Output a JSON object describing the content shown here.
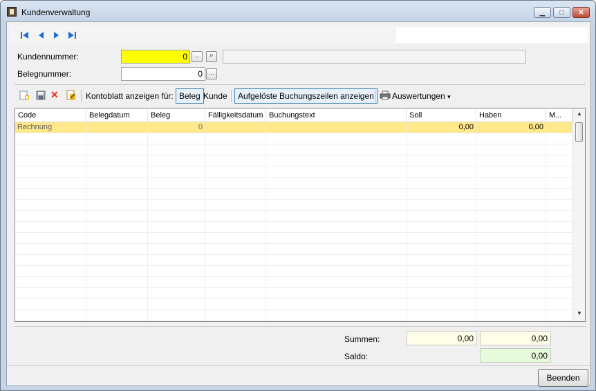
{
  "window": {
    "title": "Kundenverwaltung",
    "minimize_glyph": "▁",
    "maximize_glyph": "□",
    "close_glyph": "✕"
  },
  "nav": {
    "icons": [
      "first-record-icon",
      "previous-record-icon",
      "next-record-icon",
      "last-record-icon"
    ],
    "accent_color": "#1b6bd8"
  },
  "form": {
    "kundennummer_label": "Kundennummer:",
    "kundennummer_value": "0",
    "kundenname_value": "",
    "belegnummer_label": "Belegnummer:",
    "belegnummer_value": "0",
    "ellipsis": "...",
    "search_glyph": "⌕"
  },
  "toolbar": {
    "icons": [
      "new-icon",
      "save-icon",
      "delete-icon",
      "edit-icon"
    ],
    "kontoblatt_label": "Kontoblatt anzeigen für:",
    "beleg_toggle": "Beleg",
    "kunde_toggle": "Kunde",
    "aufgeloeste_toggle": "Aufgelöste Buchungszeilen anzeigen",
    "auswertungen_label": "Auswertungen",
    "dropdown_glyph": "▾",
    "delete_glyph": "✕"
  },
  "grid": {
    "columns": [
      "Code",
      "Belegdatum",
      "Beleg",
      "Fälligkeitsdatum",
      "Buchungstext",
      "Soll",
      "Haben",
      "M..."
    ],
    "rows": [
      {
        "code": "Rechnung",
        "belegdatum": "",
        "beleg": "0",
        "faelligkeitsdatum": "",
        "buchungstext": "",
        "soll": "0,00",
        "haben": "0,00",
        "m": ""
      }
    ],
    "selected_row_color": "#ffe88a",
    "scroll_up_glyph": "▲",
    "scroll_down_glyph": "▼"
  },
  "totals": {
    "summen_label": "Summen:",
    "summen_soll": "0,00",
    "summen_haben": "0,00",
    "saldo_label": "Saldo:",
    "saldo_value": "0,00",
    "summen_color": "#fdfde8",
    "saldo_color": "#e6fbdc"
  },
  "footer": {
    "close_button_label": "Beenden"
  }
}
